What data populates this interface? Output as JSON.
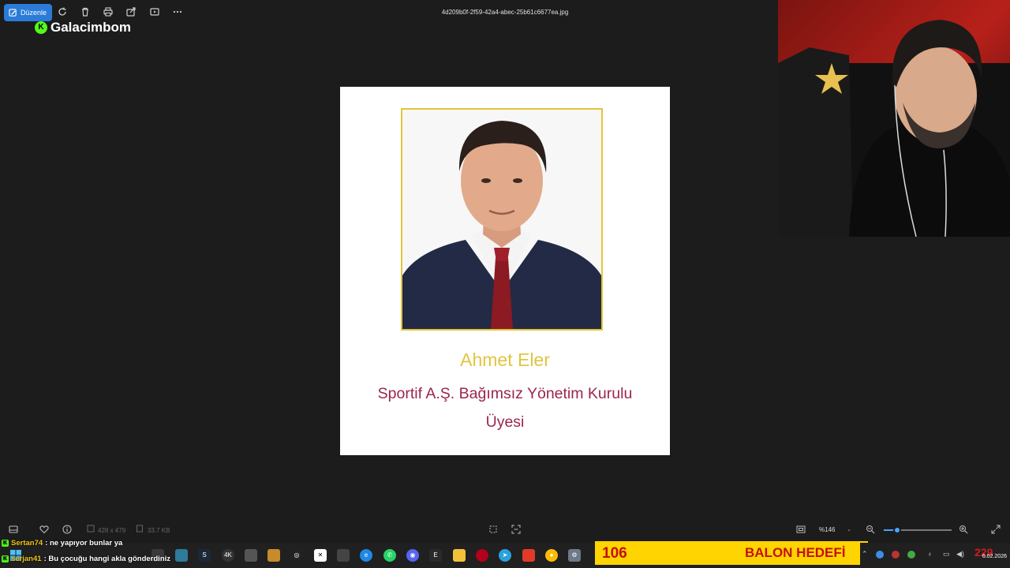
{
  "toolbar": {
    "edit_label": "Düzenle",
    "file_name": "4d209b0f-2f59-42a4-abec-25b61c6677ea.jpg",
    "icons": [
      "edit-icon",
      "rotate-icon",
      "delete-icon",
      "print-icon",
      "share-icon",
      "slideshow-icon",
      "more-icon"
    ]
  },
  "channel": {
    "badge": "K",
    "name": "Galacimbom"
  },
  "card": {
    "name": "Ahmet Eler",
    "title_line1": "Sportif A.Ş. Bağımsız Yönetim Kurulu",
    "title_line2": "Üyesi"
  },
  "bottom_bar": {
    "dimensions": "428 x 479",
    "file_size": "33.7 KB",
    "zoom": "%146",
    "zoom_level": 0.2
  },
  "chat": [
    {
      "user": "Sertan74",
      "message": ": ne yapıyor bunlar ya"
    },
    {
      "user": "serjan41",
      "message": ": Bu çocuğu hangi akla gönderdiniz"
    }
  ],
  "banner": {
    "count": "106",
    "text": "BALON HEDEFİ"
  },
  "tray": {
    "red_number": "229",
    "date": "6.02.2026"
  },
  "colors": {
    "accent": "#2b7bd8",
    "kick_green": "#53fc18",
    "name_gold": "#e1c440",
    "title_maroon": "#9c2450",
    "banner_yellow": "#ffd400",
    "banner_red": "#c41010"
  }
}
